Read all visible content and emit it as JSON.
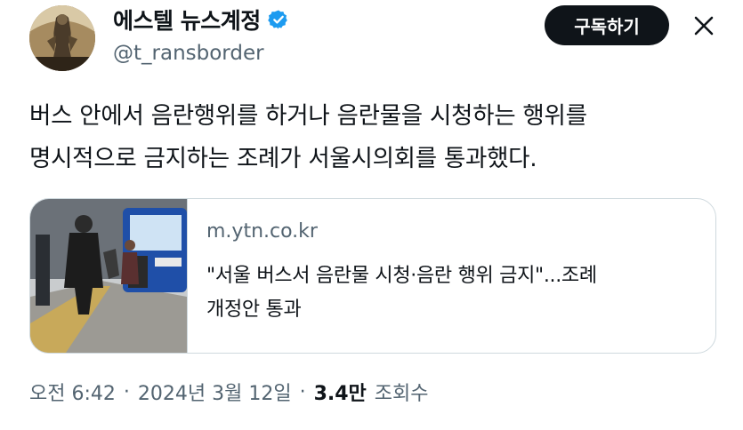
{
  "account": {
    "display_name": "에스텔 뉴스계정",
    "handle": "@t_ransborder",
    "subscribe_label": "구독하기"
  },
  "post": {
    "text_lines": [
      "버스 안에서 음란행위를 하거나 음란물을 시청하는 행위를",
      "명시적으로 금지하는 조례가 서울시의회를 통과했다."
    ]
  },
  "link_card": {
    "domain": "m.ytn.co.kr",
    "title_lines": [
      "\"서울 버스서 음란물 시청·음란 행위 금지\"...조례",
      "개정안 통과"
    ]
  },
  "meta": {
    "time": "오전 6:42",
    "separator": "·",
    "date": "2024년 3월 12일",
    "views_count": "3.4만",
    "views_label": "조회수"
  },
  "colors": {
    "verified_badge": "#1d9bf0",
    "button_bg": "#0f1419",
    "muted_text": "#536471",
    "border": "#cfd9de"
  },
  "icons": [
    "verified-badge-icon",
    "close-icon"
  ]
}
